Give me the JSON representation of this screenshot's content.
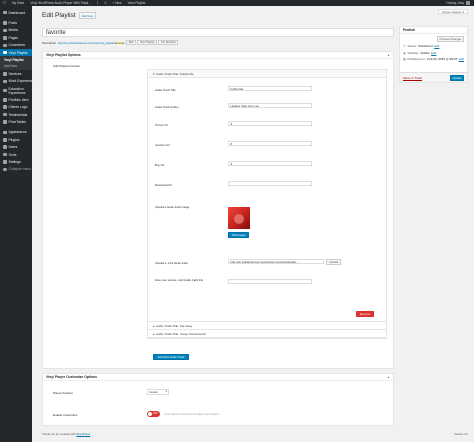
{
  "adminbar": {
    "site_name": "My Sites",
    "site_title": "Vinyl WordPress Audio Player With Playli...",
    "updates": "1",
    "comments": "0",
    "new": "+ New",
    "view": "View Playlist",
    "howdy": "Howdy, Amy"
  },
  "sidebar": {
    "items": [
      {
        "label": "Dashboard",
        "icon": "dashboard-icon"
      },
      {
        "label": "Posts",
        "icon": "pin-icon"
      },
      {
        "label": "Media",
        "icon": "media-icon"
      },
      {
        "label": "Pages",
        "icon": "page-icon"
      },
      {
        "label": "Comments",
        "icon": "comment-icon"
      },
      {
        "label": "Vinyl Playlist",
        "icon": "music-icon"
      },
      {
        "label": "Services",
        "icon": "gear-icon"
      },
      {
        "label": "Work Experience",
        "icon": "briefcase-icon"
      },
      {
        "label": "Education Experience",
        "icon": "education-icon"
      },
      {
        "label": "Portfolio Item",
        "icon": "portfolio-icon"
      },
      {
        "label": "Clients Logo",
        "icon": "logo-icon"
      },
      {
        "label": "Testimonials",
        "icon": "quote-icon"
      },
      {
        "label": "PriceTables",
        "icon": "table-icon"
      },
      {
        "label": "Appearance",
        "icon": "paintbrush-icon"
      },
      {
        "label": "Plugins",
        "icon": "plugin-icon"
      },
      {
        "label": "Users",
        "icon": "users-icon"
      },
      {
        "label": "Tools",
        "icon": "wrench-icon"
      },
      {
        "label": "Settings",
        "icon": "settings-icon"
      },
      {
        "label": "Collapse menu",
        "icon": "collapse-icon"
      }
    ],
    "submenu": [
      "Vinyl Playlist",
      "Add New"
    ]
  },
  "header": {
    "title": "Edit Playlist",
    "add_new": "Add New",
    "screen_options": "Screen Options ▾"
  },
  "post": {
    "title": "favorite",
    "permalink_label": "Permalink:",
    "permalink_url": "http://wp.intelanthemes.me/vinyl/vinyl_playlist/",
    "permalink_slug": "favorite",
    "permalink_end": "/",
    "edit_btn": "Edit",
    "view_btn": "View Playlist",
    "shortlink_btn": "Get Shortlink"
  },
  "vinyl_box": {
    "title": "Vinyl Playlist Options",
    "side_label": "Add Playlist Content",
    "track1_title": "Audio Track Title: Follow Me",
    "fields": {
      "title_label": "Audio Track Title",
      "title_value": "Follow Me",
      "author_label": "Audio Track Author",
      "author_value": "Heather Vaal, Amy Lee",
      "itunes_label": "iTunes Url",
      "itunes_value": "#",
      "amazon_label": "Amazon Url",
      "amazon_value": "#",
      "buy_label": "Buy Url",
      "buy_value": "#",
      "download_label": "Download Url",
      "download_value": "",
      "image_label": "Upload a Audio track image",
      "add_image": "Add Image",
      "mp3_label": "Upload a .mp3 Audio track",
      "mp3_value": "http://wp.intelanthemes.me/vinyl/wp-content/uploads/...",
      "upload_btn": "Upload",
      "remote_label": "Give your remote .mp3 Audio track link",
      "remote_value": ""
    },
    "remove_btn": "Remove",
    "track2_title": "Audio Track Title: Far Away",
    "track3_title": "Audio Track Title: Creep Instrumental",
    "add_track": "Add New Audio Track"
  },
  "customize_box": {
    "title": "Vinyl Player Customize Options",
    "position_label": "Player Position",
    "position_value": "Center",
    "enable_label": "Enable Customize",
    "toggle_label": "OFF",
    "hint": "If you want to customize the player just enable it"
  },
  "publish": {
    "title": "Publish",
    "preview_btn": "Preview Changes",
    "status_label": "Status:",
    "status_value": "Published",
    "visibility_label": "Visibility:",
    "visibility_value": "Public",
    "published_label": "Published on:",
    "published_value": "Feb 22, 2015 @ 08:27",
    "edit": "Edit",
    "trash": "Move to Trash",
    "update_btn": "Update"
  },
  "footer": {
    "text": "Thank you for creating with",
    "link": "WordPress",
    "version": "Version 4.2"
  },
  "colors": {
    "accent": "#0073aa",
    "admin_bar": "#23282d",
    "danger": "#dc3232"
  }
}
